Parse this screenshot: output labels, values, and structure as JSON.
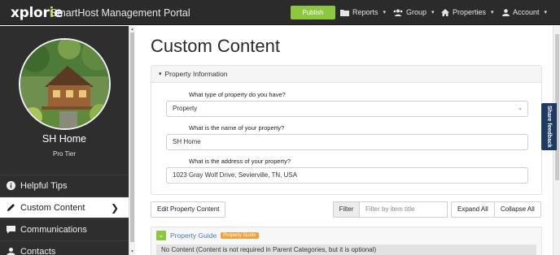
{
  "brand": {
    "logo_main": "xplor",
    "logo_accent": "i",
    "logo_tail": "e",
    "app_title": "SmartHost Management Portal"
  },
  "nav": {
    "publish": "Publish",
    "reports": "Reports",
    "group": "Group",
    "properties": "Properties",
    "account": "Account"
  },
  "sidebar": {
    "name": "SH Home",
    "tier": "Pro Tier",
    "items": [
      {
        "label": "Helpful Tips",
        "icon": "info-icon"
      },
      {
        "label": "Custom Content",
        "icon": "pencil-icon",
        "active": true
      },
      {
        "label": "Communications",
        "icon": "chat-icon"
      },
      {
        "label": "Contacts",
        "icon": "contacts-icon"
      }
    ]
  },
  "main": {
    "title": "Custom Content",
    "panel_title": "Property Information",
    "fields": [
      {
        "label": "What type of property do you have?",
        "value": "Property",
        "type": "select"
      },
      {
        "label": "What is the name of your property?",
        "value": "SH Home",
        "type": "text"
      },
      {
        "label": "What is the address of your property?",
        "value": "1023 Gray Wolf Drive, Sevierville, TN, USA",
        "type": "text"
      }
    ],
    "edit_button": "Edit Property Content",
    "filter_label": "Filter",
    "filter_placeholder": "Filter by item title",
    "expand_all": "Expand All",
    "collapse_all": "Collapse All",
    "guide_title": "Property Guide",
    "guide_badge": "Property Guide",
    "guide_note": "No Content (Content is not required in Parent Categories, but it is optional)",
    "feedback": "Share feedback"
  },
  "colors": {
    "accent_green": "#8dc63f",
    "badge_orange": "#f0a13a",
    "link_blue": "#4a7fb5",
    "feedback_navy": "#1e3a63"
  }
}
